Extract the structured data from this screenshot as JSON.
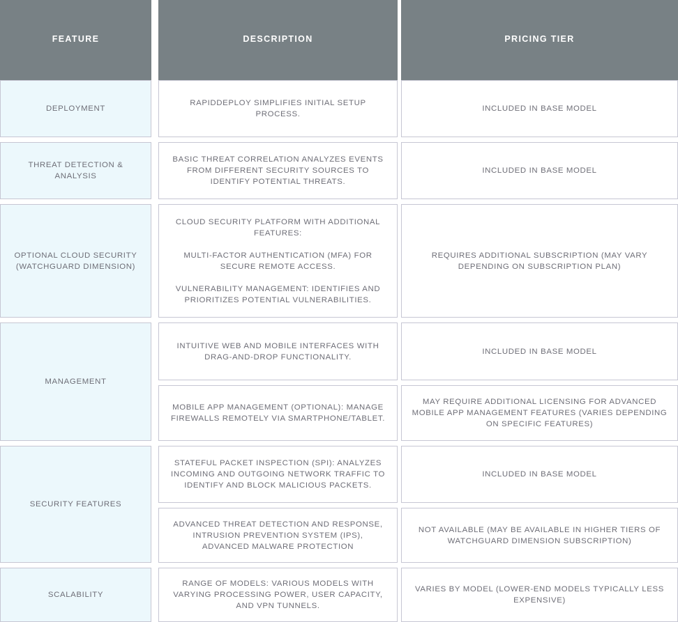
{
  "table": {
    "columns": [
      {
        "key": "feature",
        "label": "FEATURE"
      },
      {
        "key": "description",
        "label": "DESCRIPTION"
      },
      {
        "key": "pricing",
        "label": "PRICING TIER"
      }
    ],
    "colors": {
      "header_bg": "#788185",
      "header_text": "#ffffff",
      "feature_cell_bg": "#ecf8fc",
      "cell_bg": "#ffffff",
      "cell_border": "#c6c6d3",
      "body_text": "#6e6e77"
    },
    "rows": [
      {
        "feature": "DEPLOYMENT",
        "description": "RAPIDDEPLOY SIMPLIFIES INITIAL SETUP PROCESS.",
        "pricing": "INCLUDED IN BASE MODEL"
      },
      {
        "feature": "THREAT DETECTION & ANALYSIS",
        "description": "BASIC THREAT CORRELATION ANALYZES EVENTS FROM DIFFERENT SECURITY SOURCES TO IDENTIFY POTENTIAL THREATS.",
        "pricing": "INCLUDED IN BASE MODEL"
      },
      {
        "feature": "OPTIONAL CLOUD SECURITY (WATCHGUARD DIMENSION)",
        "description": "CLOUD SECURITY PLATFORM WITH ADDITIONAL FEATURES:\n\nMULTI-FACTOR AUTHENTICATION (MFA) FOR SECURE REMOTE ACCESS.\n\nVULNERABILITY MANAGEMENT: IDENTIFIES AND PRIORITIZES POTENTIAL VULNERABILITIES.",
        "pricing": "REQUIRES ADDITIONAL SUBSCRIPTION (MAY VARY DEPENDING ON SUBSCRIPTION PLAN)"
      },
      {
        "feature": "MANAGEMENT",
        "description_a": "INTUITIVE WEB AND MOBILE INTERFACES WITH DRAG-AND-DROP FUNCTIONALITY.",
        "description_b": "MOBILE APP MANAGEMENT (OPTIONAL): MANAGE FIREWALLS REMOTELY VIA SMARTPHONE/TABLET.",
        "pricing_a": "INCLUDED IN BASE MODEL",
        "pricing_b": "MAY REQUIRE ADDITIONAL LICENSING FOR ADVANCED MOBILE APP MANAGEMENT FEATURES (VARIES DEPENDING ON SPECIFIC FEATURES)"
      },
      {
        "feature": "SECURITY FEATURES",
        "description_a": "STATEFUL PACKET INSPECTION (SPI): ANALYZES INCOMING AND OUTGOING NETWORK TRAFFIC TO IDENTIFY AND BLOCK MALICIOUS PACKETS.",
        "description_b": "ADVANCED THREAT DETECTION AND RESPONSE, INTRUSION PREVENTION SYSTEM (IPS), ADVANCED MALWARE PROTECTION",
        "pricing_a": "INCLUDED IN BASE MODEL",
        "pricing_b": "NOT AVAILABLE (MAY BE AVAILABLE IN HIGHER TIERS OF WATCHGUARD DIMENSION SUBSCRIPTION)"
      },
      {
        "feature": "SCALABILITY",
        "description": "RANGE OF MODELS: VARIOUS MODELS WITH VARYING PROCESSING POWER, USER CAPACITY, AND VPN TUNNELS.",
        "pricing": "VARIES BY MODEL (LOWER-END MODELS TYPICALLY LESS EXPENSIVE)"
      }
    ]
  }
}
